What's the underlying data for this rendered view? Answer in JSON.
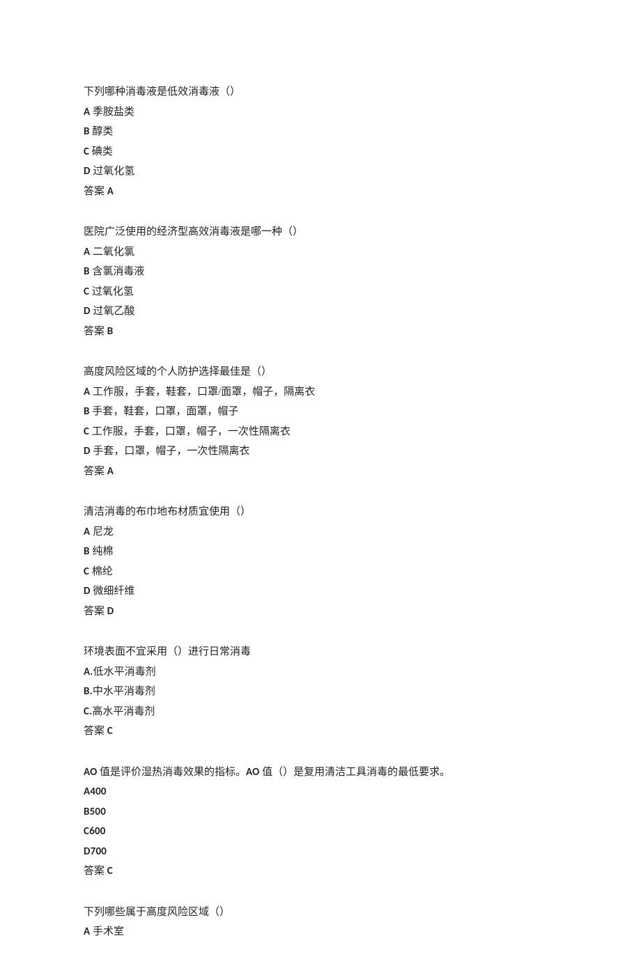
{
  "questions": [
    {
      "stem": "下列哪种消毒液是低效消毒液（）",
      "options": [
        {
          "letter": "A",
          "sep": " ",
          "text": "季胺盐类"
        },
        {
          "letter": "B",
          "sep": " ",
          "text": "醇类"
        },
        {
          "letter": "C",
          "sep": " ",
          "text": "碘类"
        },
        {
          "letter": "D",
          "sep": " ",
          "text": "过氧化氢"
        }
      ],
      "answerLabel": "答案 ",
      "answerLetter": "A"
    },
    {
      "stem": "医院广泛使用的经济型高效消毒液是哪一种（）",
      "options": [
        {
          "letter": "A",
          "sep": " ",
          "text": "二氧化氯"
        },
        {
          "letter": "B",
          "sep": " ",
          "text": "含氯消毒液"
        },
        {
          "letter": "C",
          "sep": " ",
          "text": "过氧化氢"
        },
        {
          "letter": "D",
          "sep": " ",
          "text": "过氧乙酸"
        }
      ],
      "answerLabel": "答案 ",
      "answerLetter": "B"
    },
    {
      "stem": "高度风险区域的个人防护选择最佳是（）",
      "options": [
        {
          "letter": "A",
          "sep": " ",
          "text": "工作服，手套，鞋套，口罩/面罩，帽子，隔离衣"
        },
        {
          "letter": "B",
          "sep": " ",
          "text": "手套，鞋套，口罩，面罩，帽子"
        },
        {
          "letter": "C",
          "sep": " ",
          "text": "工作服，手套，口罩，帽子，一次性隔离衣"
        },
        {
          "letter": "D",
          "sep": " ",
          "text": "手套，口罩，帽子，一次性隔离衣"
        }
      ],
      "answerLabel": "答案 ",
      "answerLetter": "A"
    },
    {
      "stem": "清洁消毒的布巾地布材质宜使用（）",
      "options": [
        {
          "letter": "A",
          "sep": " ",
          "text": "尼龙"
        },
        {
          "letter": "B",
          "sep": " ",
          "text": "纯棉"
        },
        {
          "letter": "C",
          "sep": " ",
          "text": "棉纶"
        },
        {
          "letter": "D",
          "sep": " ",
          "text": "微细纤维"
        }
      ],
      "answerLabel": "答案 ",
      "answerLetter": "D"
    },
    {
      "stem": "环境表面不宜采用（）进行日常消毒",
      "options": [
        {
          "letter": "A.",
          "sep": "",
          "text": "低水平消毒剂"
        },
        {
          "letter": "B.",
          "sep": "",
          "text": "中水平消毒剂"
        },
        {
          "letter": "C.",
          "sep": "",
          "text": "高水平消毒剂"
        }
      ],
      "answerLabel": "答案 ",
      "answerLetter": "C"
    },
    {
      "stemParts": [
        {
          "type": "latin",
          "text": "AO "
        },
        {
          "type": "cjk",
          "text": "值是评价湿热消毒效果的指标。"
        },
        {
          "type": "latin",
          "text": "AO "
        },
        {
          "type": "cjk",
          "text": "值（）是复用清洁工具消毒的最低要求。"
        }
      ],
      "options": [
        {
          "letter": "A400",
          "sep": "",
          "text": ""
        },
        {
          "letter": "B500",
          "sep": "",
          "text": ""
        },
        {
          "letter": "C600",
          "sep": "",
          "text": ""
        },
        {
          "letter": "D700",
          "sep": "",
          "text": ""
        }
      ],
      "answerLabel": "答案 ",
      "answerLetter": "C"
    },
    {
      "stem": "下列哪些属于高度风险区域（）",
      "options": [
        {
          "letter": "A",
          "sep": " ",
          "text": "手术室"
        }
      ],
      "answerLabel": "",
      "answerLetter": ""
    }
  ]
}
